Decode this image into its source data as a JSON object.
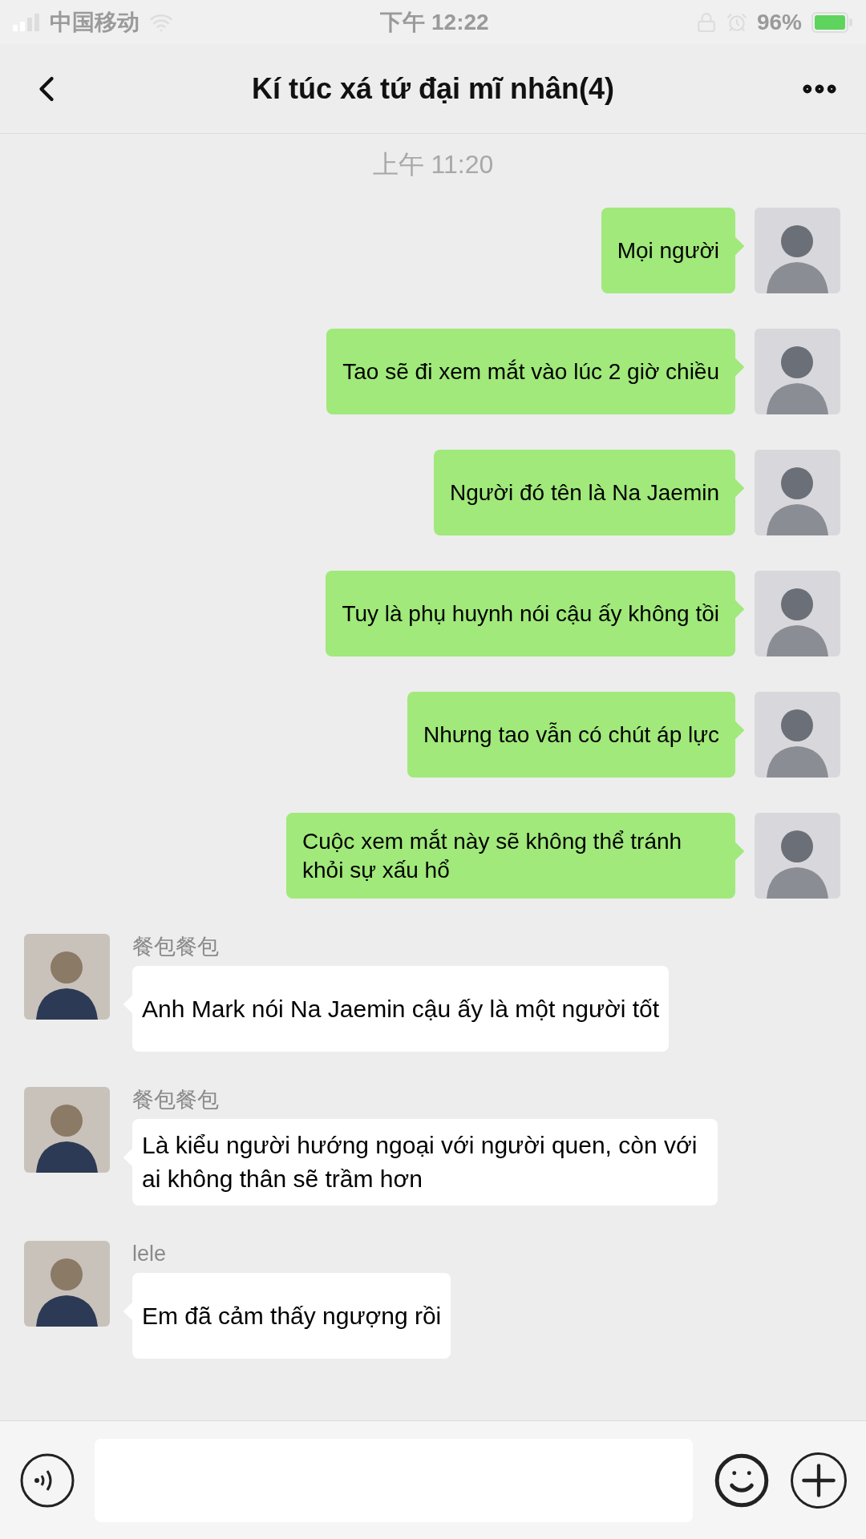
{
  "status_bar": {
    "carrier": "中国移动",
    "time": "下午 12:22",
    "battery": "96%"
  },
  "header": {
    "title": "Kí túc xá tứ đại mĩ nhân(4)"
  },
  "timestamp": "上午 11:20",
  "messages": [
    {
      "kind": "outgoing",
      "text": "Mọi người"
    },
    {
      "kind": "outgoing",
      "text": "Tao sẽ đi xem mắt vào lúc 2 giờ chiều"
    },
    {
      "kind": "outgoing",
      "text": "Người đó tên là Na Jaemin"
    },
    {
      "kind": "outgoing",
      "text": "Tuy là phụ huynh nói cậu ấy không tồi"
    },
    {
      "kind": "outgoing",
      "text": "Nhưng tao vẫn có chút áp lực"
    },
    {
      "kind": "outgoing",
      "text": "Cuộc xem mắt này sẽ không thể tránh khỏi sự xấu hổ"
    },
    {
      "kind": "incoming",
      "sender": "餐包餐包",
      "text": "Anh Mark nói Na Jaemin cậu ấy là một người tốt"
    },
    {
      "kind": "incoming",
      "sender": "餐包餐包",
      "text": "Là kiểu người hướng ngoại với người quen, còn với ai không thân sẽ trầm hơn"
    },
    {
      "kind": "incoming",
      "sender": "lele",
      "text": "Em đã cảm thấy ngượng rồi"
    }
  ]
}
